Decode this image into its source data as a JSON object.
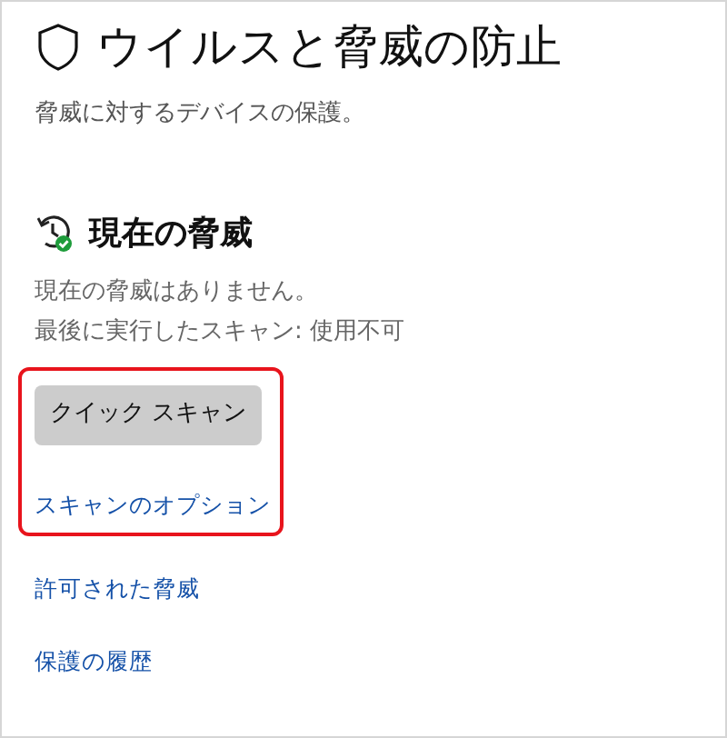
{
  "page": {
    "title": "ウイルスと脅威の防止",
    "subtitle": "脅威に対するデバイスの保護。"
  },
  "section": {
    "heading": "現在の脅威",
    "status_lines": [
      "現在の脅威はありません。",
      "最後に実行したスキャン: 使用不可"
    ]
  },
  "scan_actions": {
    "highlighted": true,
    "button": "クイック スキャン",
    "link": "スキャンのオプション"
  },
  "links": [
    "許可された脅威",
    "保護の履歴"
  ]
}
